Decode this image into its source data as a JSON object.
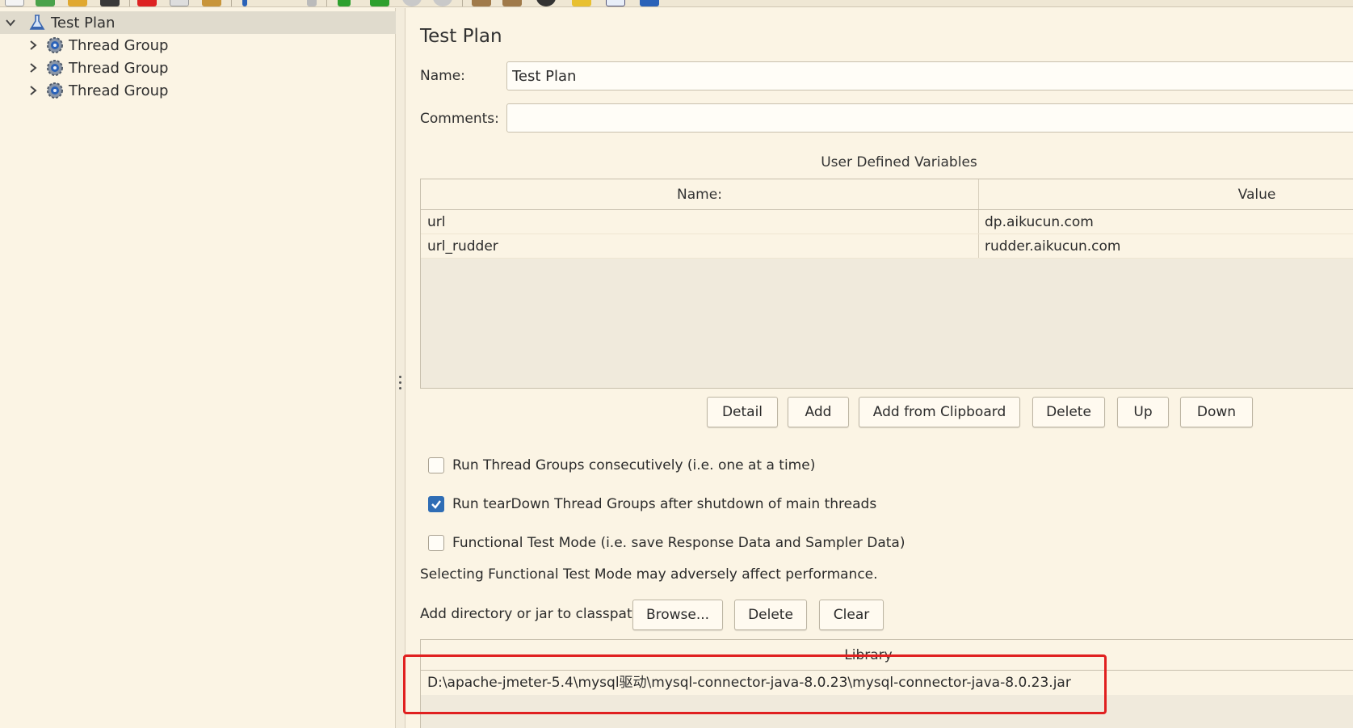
{
  "toolbar": {
    "icons": [
      "new-icon",
      "templates-icon",
      "open-icon",
      "save-icon",
      "cut-icon",
      "copy-icon",
      "paste-icon",
      "expand-icon",
      "toggle-icon",
      "start-icon",
      "start-no-pauses-icon",
      "stop-icon",
      "shutdown-icon",
      "clear-icon",
      "clear-all-icon",
      "search-icon",
      "reset-search-icon",
      "function-helper-icon",
      "help-icon"
    ]
  },
  "tree": {
    "root": {
      "label": "Test Plan",
      "icon": "flask-icon"
    },
    "children": [
      {
        "label": "Thread Group",
        "icon": "gear-icon"
      },
      {
        "label": "Thread Group",
        "icon": "gear-icon"
      },
      {
        "label": "Thread Group",
        "icon": "gear-icon"
      }
    ]
  },
  "main": {
    "title": "Test Plan",
    "name_label": "Name:",
    "name_value": "Test Plan",
    "comments_label": "Comments:",
    "comments_value": "",
    "udv_title": "User Defined Variables",
    "udv_columns": [
      "Name:",
      "Value"
    ],
    "udv_rows": [
      {
        "name": "url",
        "value": "dp.aikucun.com"
      },
      {
        "name": "url_rudder",
        "value": "rudder.aikucun.com"
      }
    ],
    "udv_buttons": {
      "detail": "Detail",
      "add": "Add",
      "add_clipboard": "Add from Clipboard",
      "delete": "Delete",
      "up": "Up",
      "down": "Down"
    },
    "options": {
      "run_consecutively": {
        "label": "Run Thread Groups consecutively (i.e. one at a time)",
        "checked": false
      },
      "run_teardown": {
        "label": "Run tearDown Thread Groups after shutdown of main threads",
        "checked": true
      },
      "functional_mode": {
        "label": "Functional Test Mode (i.e. save Response Data and Sampler Data)",
        "checked": false
      }
    },
    "functional_note": "Selecting Functional Test Mode may adversely affect performance.",
    "classpath_label": "Add directory or jar to classpath",
    "classpath_buttons": {
      "browse": "Browse...",
      "delete": "Delete",
      "clear": "Clear"
    },
    "library_header": "Library",
    "library_rows": [
      "D:\\apache-jmeter-5.4\\mysql驱动\\mysql-connector-java-8.0.23\\mysql-connector-java-8.0.23.jar"
    ]
  },
  "colors": {
    "background": "#fbf4e4",
    "selection": "#e0dbcd",
    "checkbox_checked": "#2f6db5",
    "highlight": "#e02020"
  }
}
